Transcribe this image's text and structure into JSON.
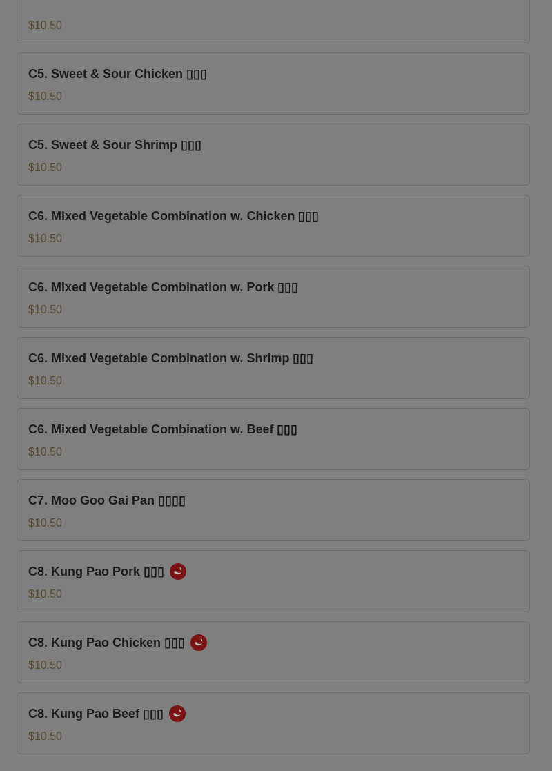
{
  "menu_items": [
    {
      "price": "$10.50"
    },
    {
      "title": "C5. Sweet & Sour Chicken ▯▯▯",
      "price": "$10.50",
      "spicy": false
    },
    {
      "title": "C5. Sweet & Sour Shrimp ▯▯▯",
      "price": "$10.50",
      "spicy": false
    },
    {
      "title": "C6. Mixed Vegetable Combination w. Chicken ▯▯▯",
      "price": "$10.50",
      "spicy": false
    },
    {
      "title": "C6. Mixed Vegetable Combination w. Pork ▯▯▯",
      "price": "$10.50",
      "spicy": false
    },
    {
      "title": "C6. Mixed Vegetable Combination w. Shrimp ▯▯▯",
      "price": "$10.50",
      "spicy": false
    },
    {
      "title": "C6. Mixed Vegetable Combination w. Beef ▯▯▯",
      "price": "$10.50",
      "spicy": false
    },
    {
      "title": "C7. Moo Goo Gai Pan ▯▯▯▯",
      "price": "$10.50",
      "spicy": false
    },
    {
      "title": "C8. Kung Pao Pork ▯▯▯",
      "price": "$10.50",
      "spicy": true
    },
    {
      "title": "C8. Kung Pao Chicken ▯▯▯",
      "price": "$10.50",
      "spicy": true
    },
    {
      "title": "C8. Kung Pao Beef ▯▯▯",
      "price": "$10.50",
      "spicy": true
    }
  ]
}
